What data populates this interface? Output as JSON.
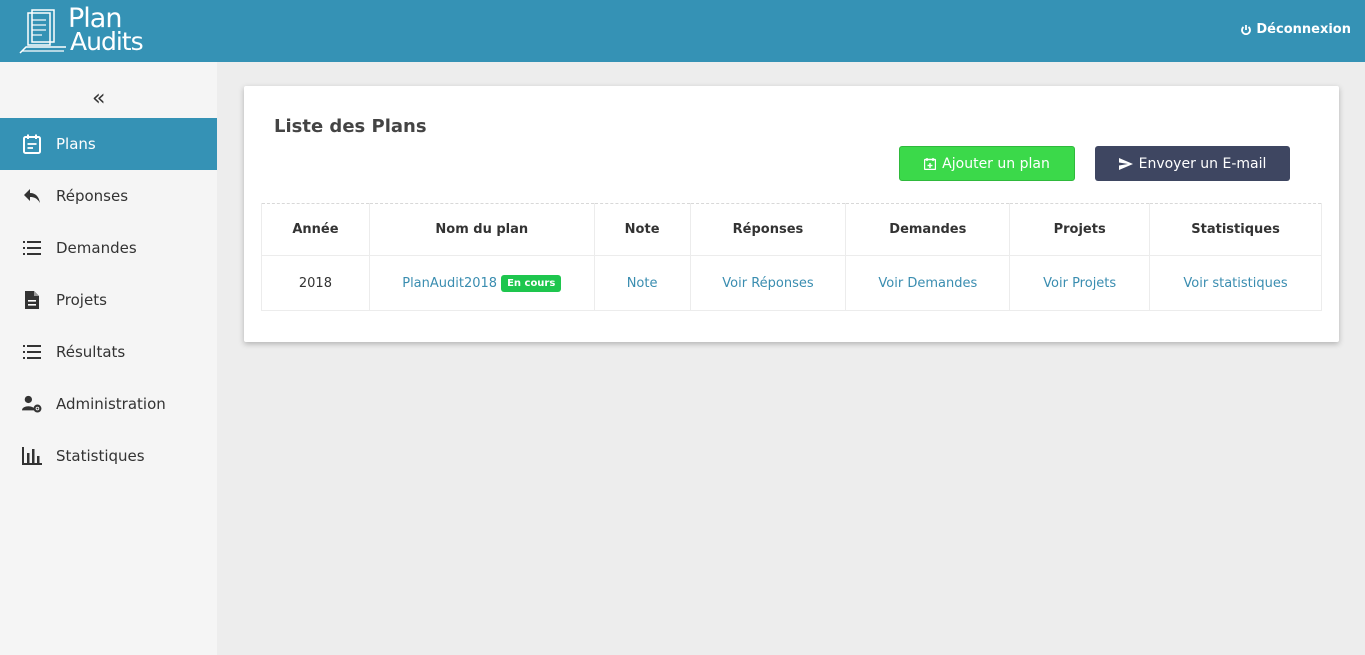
{
  "header": {
    "logo_line1": "Plan",
    "logo_line2": "Audits",
    "logout_label": "Déconnexion",
    "logout_icon": "power-icon"
  },
  "sidebar": {
    "collapse_icon": "«",
    "items": [
      {
        "label": "Plans",
        "icon": "calendar-icon",
        "active": true
      },
      {
        "label": "Réponses",
        "icon": "reply-icon",
        "active": false
      },
      {
        "label": "Demandes",
        "icon": "list-icon",
        "active": false
      },
      {
        "label": "Projets",
        "icon": "document-icon",
        "active": false
      },
      {
        "label": "Résultats",
        "icon": "list-icon",
        "active": false
      },
      {
        "label": "Administration",
        "icon": "user-settings-icon",
        "active": false
      },
      {
        "label": "Statistiques",
        "icon": "bar-chart-icon",
        "active": false
      }
    ]
  },
  "main": {
    "title": "Liste des Plans",
    "add_button": "Ajouter un plan",
    "email_button": "Envoyer un E-mail",
    "table": {
      "columns": [
        "Année",
        "Nom du plan",
        "Note",
        "Réponses",
        "Demandes",
        "Projets",
        "Statistiques"
      ],
      "rows": [
        {
          "year": "2018",
          "plan_name": "PlanAudit2018",
          "status": "En cours",
          "note": "Note",
          "responses": "Voir Réponses",
          "requests": "Voir Demandes",
          "projects": "Voir Projets",
          "stats": "Voir statistiques"
        }
      ]
    }
  },
  "colors": {
    "header_bg": "#3592b5",
    "active_nav": "#3592b5",
    "add_button": "#3bd94a",
    "email_button": "#3e4661",
    "badge": "#1ec64e",
    "link": "#3a8db0"
  }
}
